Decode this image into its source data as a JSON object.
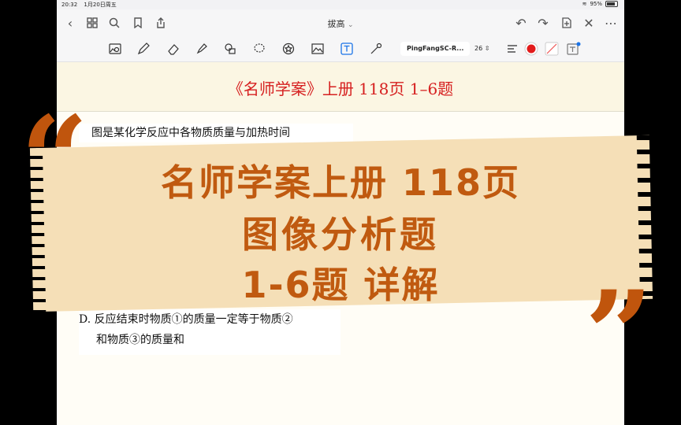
{
  "status": {
    "time": "20:32",
    "date": "1月20日周五",
    "wifi": "wifi",
    "battery": "95%"
  },
  "nav": {
    "title": "拔高",
    "title_chevron": "⌄"
  },
  "toolbar": {
    "font_name": "PingFangSC-R...",
    "font_size": "26",
    "ink_color": "#e21b1b"
  },
  "document": {
    "header": "《名师学案》上册 118页 1–6题",
    "question_line_1": "图是某化学反应中各物质质量与加热时间",
    "answer_line_1": "D. 反应结束时物质①的质量一定等于物质②",
    "answer_line_2": "和物质③的质量和"
  },
  "overlay": {
    "line1": "名师学案上册 118页",
    "line2": "图像分析题",
    "line3": "1-6题  详解",
    "open_quote": "“",
    "close_quote": "”",
    "text_color": "#c05a10",
    "band_color": "#f5dfb7"
  }
}
